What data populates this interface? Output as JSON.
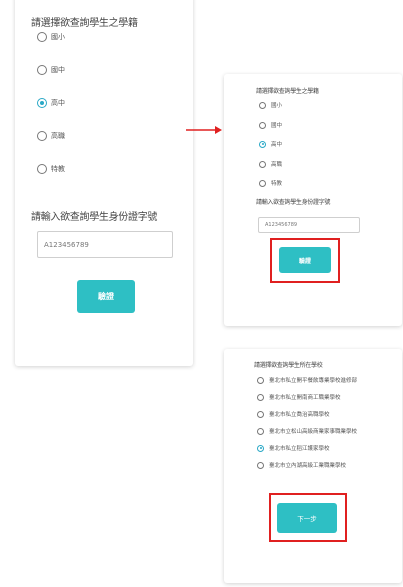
{
  "left_card": {
    "group_title": "請選擇欲查詢學生之學籍",
    "options": [
      "國小",
      "國中",
      "高中",
      "高職",
      "特教"
    ],
    "selected_index": 2,
    "id_label": "請輸入欲查詢學生身份證字號",
    "id_value": "A123456789",
    "verify_label": "驗證"
  },
  "right_top_card": {
    "group_title": "請選擇欲查詢學生之學籍",
    "options": [
      "國小",
      "國中",
      "高中",
      "高職",
      "特教"
    ],
    "selected_index": 2,
    "id_label": "請輸入欲查詢學生身份證字號",
    "id_value": "A123456789",
    "verify_label": "驗證"
  },
  "right_bottom_card": {
    "school_title": "請選擇欲查詢學生所在學校",
    "schools": [
      "臺北市私立開平餐飲專業學校進修部",
      "臺北市私立開南商工職業學校",
      "臺北市私立喬治高職學校",
      "臺北市立松山高級商業家事職業學校",
      "臺北市私立稻江護家學校",
      "臺北市立內湖高級工業職業學校"
    ],
    "selected_index": 4,
    "next_label": "下一步"
  },
  "colors": {
    "accent": "#2ebfc4",
    "radio_checked": "#2aa8c6",
    "highlight": "#e02020",
    "arrow": "#e02020"
  }
}
